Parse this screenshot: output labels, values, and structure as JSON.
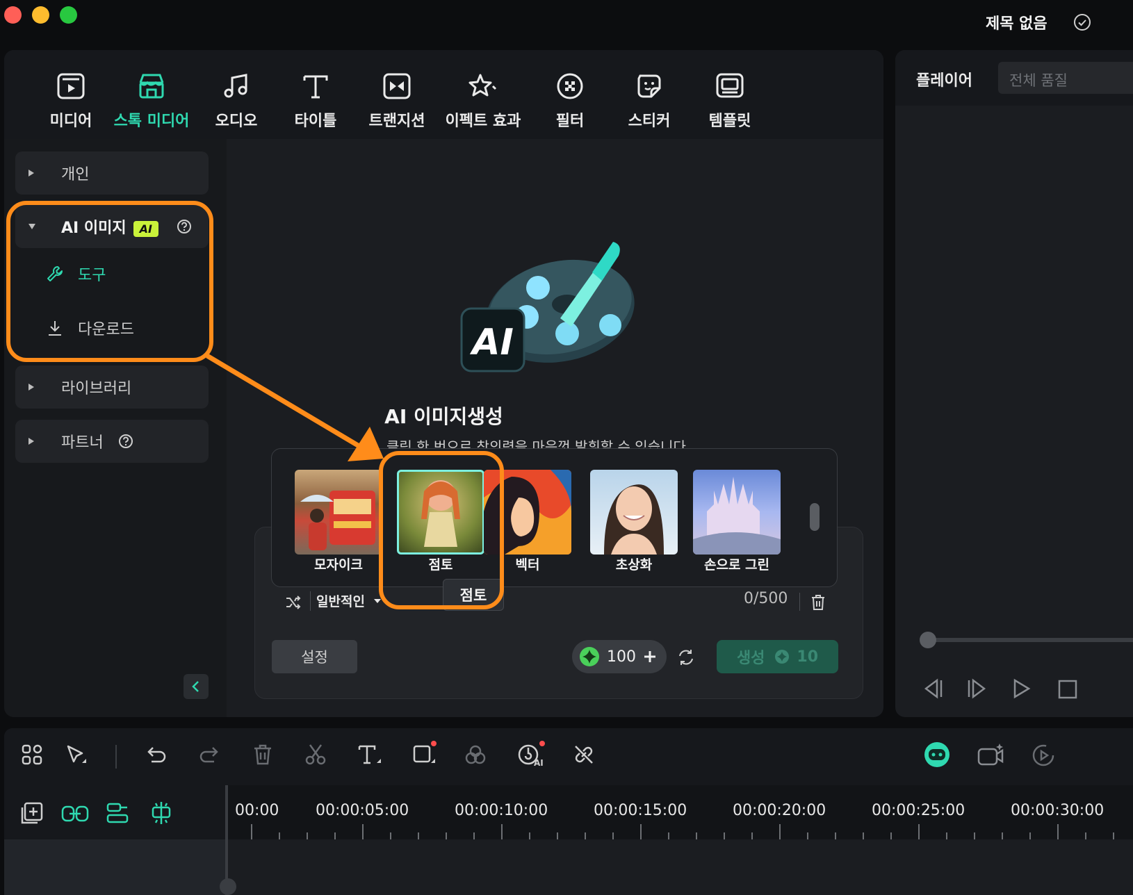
{
  "window": {
    "title": "제목 없음"
  },
  "tabs": [
    {
      "label": "미디어",
      "icon": "media-icon"
    },
    {
      "label": "스톡 미디어",
      "icon": "stock-media-icon",
      "active": true
    },
    {
      "label": "오디오",
      "icon": "music-note-icon"
    },
    {
      "label": "타이틀",
      "icon": "title-t-icon"
    },
    {
      "label": "트랜지션",
      "icon": "transition-icon"
    },
    {
      "label": "이펙트 효과",
      "icon": "effects-star-icon"
    },
    {
      "label": "필터",
      "icon": "filter-icon"
    },
    {
      "label": "스티커",
      "icon": "sticker-icon"
    },
    {
      "label": "템플릿",
      "icon": "template-icon"
    }
  ],
  "sidebar": {
    "personal": "개인",
    "ai_image": {
      "label": "AI 이미지",
      "badge": "AI",
      "help_icon": "help-circle-icon"
    },
    "tools": "도구",
    "download": "다운로드",
    "library": "라이브러리",
    "partner": "파트너"
  },
  "center": {
    "title": "AI 이미지생성",
    "subtitle": "클릭 한 번으로 창의력을 마음껏 발휘할 수 있습니다"
  },
  "styles": [
    {
      "label": "모자이크"
    },
    {
      "label": "점토",
      "selected": true
    },
    {
      "label": "벡터"
    },
    {
      "label": "초상화"
    },
    {
      "label": "손으로 그린"
    }
  ],
  "prompt": {
    "style_select": "일반적인",
    "char_count": "0/500",
    "tooltip": "점토"
  },
  "actions": {
    "settings": "설정",
    "credits": "100",
    "generate": "생성",
    "generate_cost": "10"
  },
  "player": {
    "title": "플레이어",
    "quality": "전체 품질"
  },
  "timeline": {
    "timecodes": [
      "00:00",
      "00:00:05:00",
      "00:00:10:00",
      "00:00:15:00",
      "00:00:20:00",
      "00:00:25:00",
      "00:00:30:00"
    ]
  },
  "colors": {
    "accent": "#2fd9b0",
    "highlight": "#ff8c1a",
    "ai_badge": "#c9f23a"
  }
}
